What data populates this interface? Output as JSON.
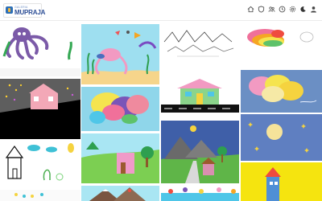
{
  "app": {
    "logo_small": "GALERIA",
    "logo_big": "MUPRAJA"
  },
  "nav": {
    "icons": [
      "home-icon",
      "shield-icon",
      "group-icon",
      "clock-icon",
      "settings-icon",
      "moon-icon",
      "user-icon"
    ]
  },
  "gallery": {
    "artworks": [
      "octopus-drawing",
      "underwater-scene-drawing",
      "mountain-sketch-drawing",
      "rainbow-cloud-drawing",
      "pink-house-night-drawing",
      "colorful-shapes-drawing",
      "green-house-road-drawing",
      "colorful-cloud-drawing",
      "sketch-house-drawing",
      "pink-house-field-drawing",
      "mountain-road-drawing",
      "moon-night-drawing",
      "mountain-sea-drawing",
      "flowers-water-drawing",
      "blue-house-yellow-drawing"
    ]
  }
}
